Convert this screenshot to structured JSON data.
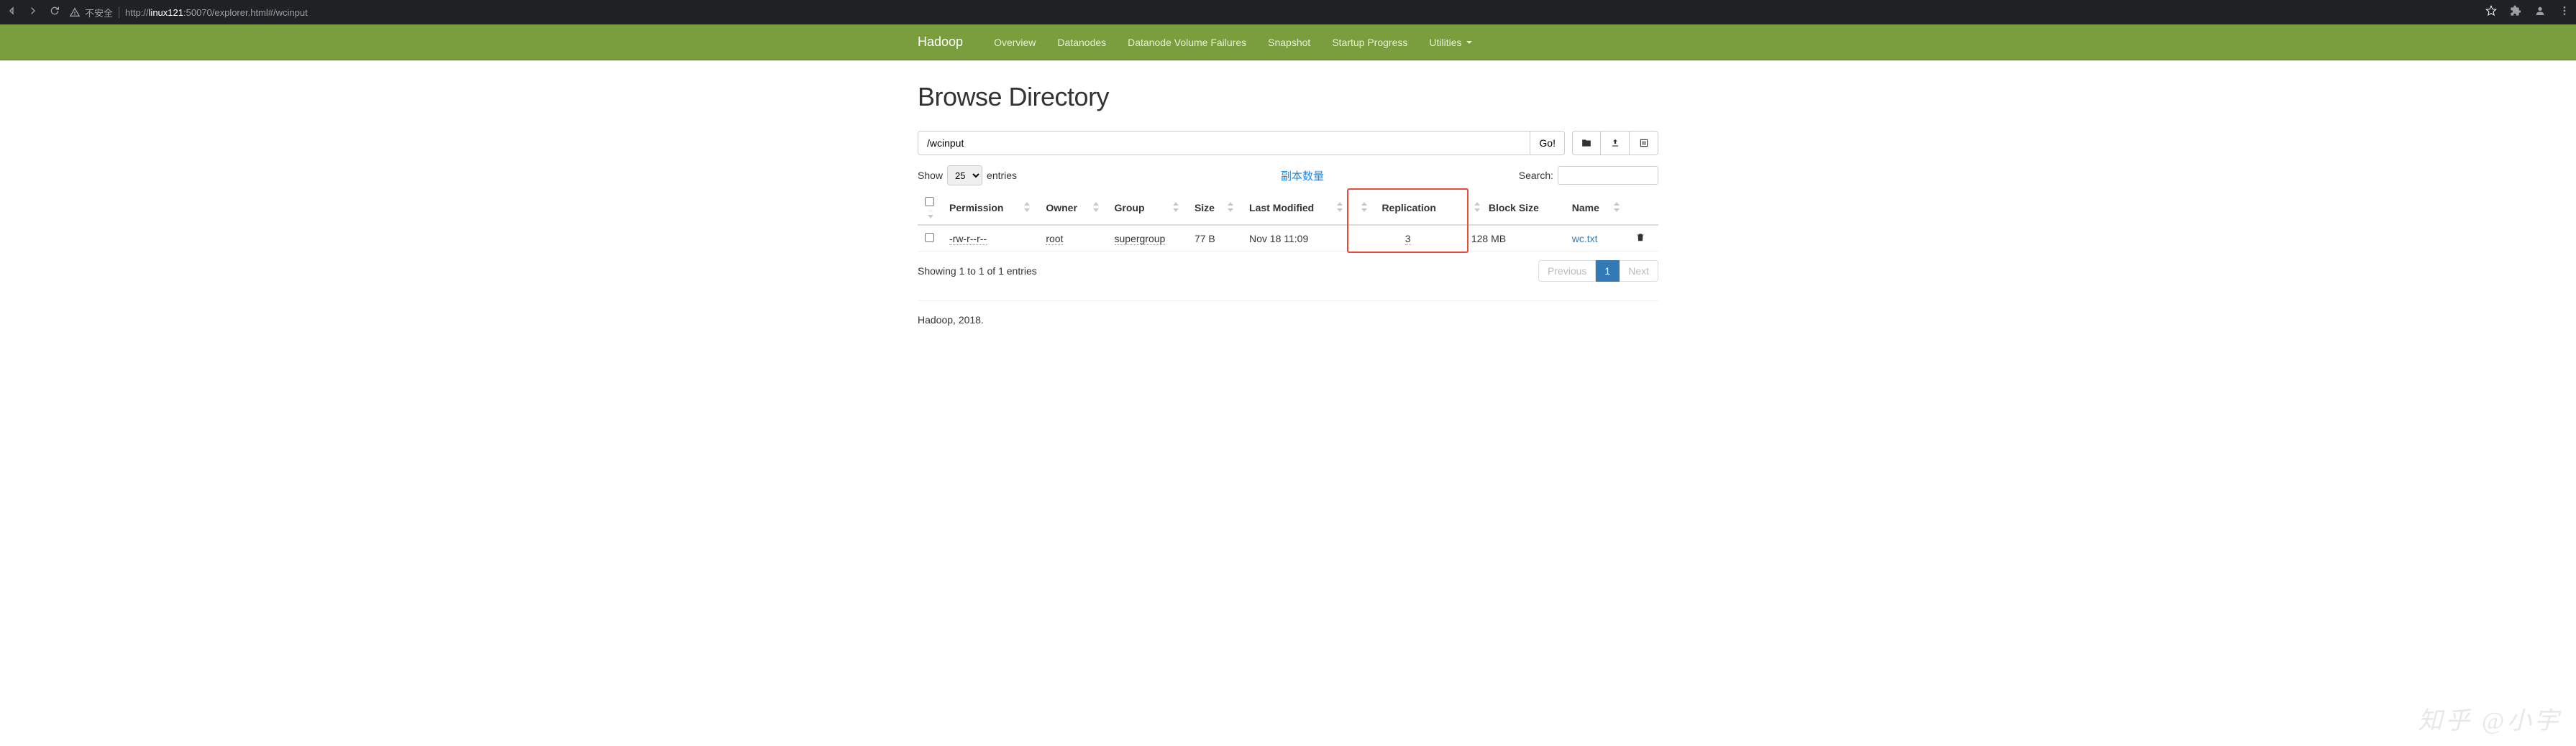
{
  "browser": {
    "security_label": "不安全",
    "url_prefix": "http://",
    "url_host": "linux121",
    "url_rest": ":50070/explorer.html#/wcinput"
  },
  "navbar": {
    "brand": "Hadoop",
    "items": [
      "Overview",
      "Datanodes",
      "Datanode Volume Failures",
      "Snapshot",
      "Startup Progress",
      "Utilities"
    ]
  },
  "page": {
    "title": "Browse Directory",
    "path_value": "/wcinput",
    "go_label": "Go!",
    "show_label": "Show",
    "entries_label": "entries",
    "page_size": "25",
    "annotation": "副本数量",
    "search_label": "Search:",
    "table_info": "Showing 1 to 1 of 1 entries",
    "prev_label": "Previous",
    "next_label": "Next",
    "current_page": "1",
    "footer": "Hadoop, 2018."
  },
  "columns": [
    "Permission",
    "Owner",
    "Group",
    "Size",
    "Last Modified",
    "Replication",
    "Block Size",
    "Name"
  ],
  "rows": [
    {
      "permission": "-rw-r--r--",
      "owner": "root",
      "group": "supergroup",
      "size": "77 B",
      "last_modified": "Nov 18 11:09",
      "replication": "3",
      "block_size": "128 MB",
      "name": "wc.txt"
    }
  ],
  "watermark": "知乎 @小宇"
}
